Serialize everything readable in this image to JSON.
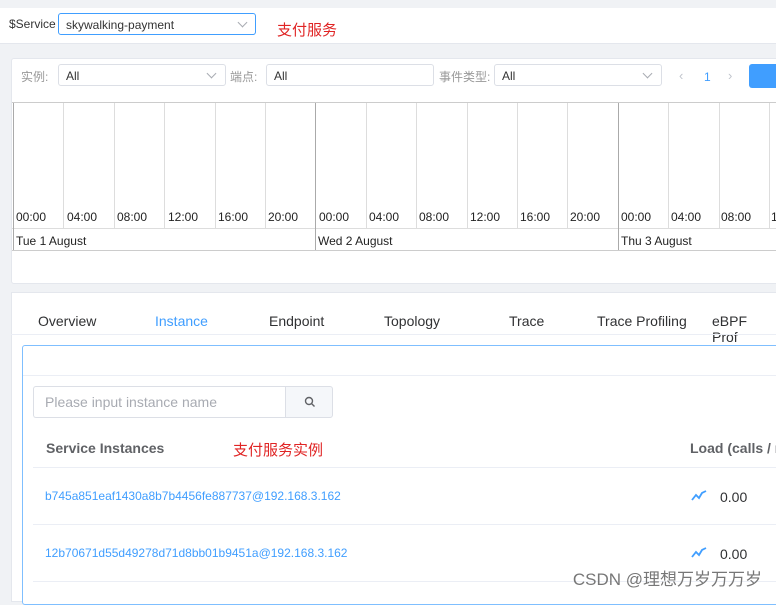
{
  "service": {
    "label": "$Service",
    "selected": "skywalking-payment",
    "annotation": "支付服务"
  },
  "events": {
    "instance_label": "实例:",
    "instance_value": "All",
    "endpoint_label": "端点:",
    "endpoint_value": "All",
    "type_label": "事件类型:",
    "type_value": "All",
    "pager_prev": "‹",
    "pager_page": "1",
    "pager_next": "›"
  },
  "timeline": {
    "ticks": [
      "00:00",
      "04:00",
      "08:00",
      "12:00",
      "16:00",
      "20:00",
      "00:00",
      "04:00",
      "08:00",
      "12:00",
      "16:00",
      "20:00",
      "00:00",
      "04:00",
      "08:00",
      "1"
    ],
    "days": [
      "Tue 1 August",
      "Wed 2 August",
      "Thu 3 August"
    ]
  },
  "tabs": [
    "Overview",
    "Instance",
    "Endpoint",
    "Topology",
    "Trace",
    "Trace Profiling",
    "eBPF Prof"
  ],
  "active_tab": "Instance",
  "instances": {
    "search_placeholder": "Please input instance name",
    "col_instances": "Service Instances",
    "annotation": "支付服务实例",
    "col_load": "Load (calls / n",
    "rows": [
      {
        "name": "b745a851eaf1430a8b7b4456fe887737@192.168.3.162",
        "load": "0.00"
      },
      {
        "name": "12b70671d55d49278d71d8bb01b9451a@192.168.3.162",
        "load": "0.00"
      }
    ]
  },
  "watermark": "CSDN @理想万岁万万岁",
  "colors": {
    "accent": "#409eff",
    "annotation": "#e02424"
  }
}
